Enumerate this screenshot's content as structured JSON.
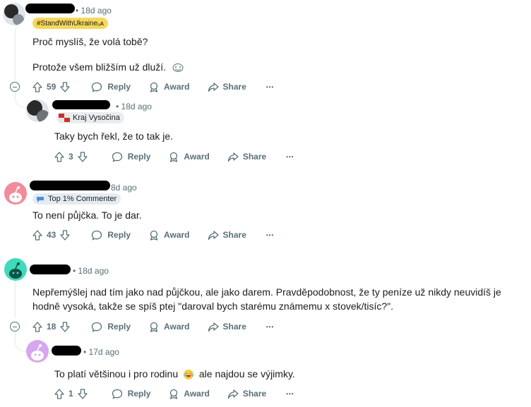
{
  "comments": [
    {
      "time": "18d ago",
      "flair": "#StandWithUkraineᵤᴀ",
      "lines": [
        "Proč myslíš, že volá tobě?",
        "Protože všem bližším už dluží."
      ],
      "votes": "59",
      "reply": "Reply",
      "award": "Award",
      "share": "Share"
    },
    {
      "time": "18d ago",
      "flair": "Kraj Vysočina",
      "text": "Taky bych řekl, že to tak je.",
      "votes": "3",
      "reply": "Reply",
      "award": "Award",
      "share": "Share"
    },
    {
      "time": "8d ago",
      "flair": "Top 1% Commenter",
      "text": "To není půjčka. To je dar.",
      "votes": "43",
      "reply": "Reply",
      "award": "Award",
      "share": "Share"
    },
    {
      "time": "18d ago",
      "text": "Nepřemýšlej nad tím jako nad půjčkou, ale jako darem. Pravděpodobnost, že ty peníze už nikdy neuvidíš je hodně vysoká, takže se spíš ptej \"daroval bych starému známemu x stovek/tisíc?\".",
      "votes": "18",
      "reply": "Reply",
      "award": "Award",
      "share": "Share"
    },
    {
      "time": "17d ago",
      "text_before": "To platí většinou i pro rodinu",
      "text_after": "ale najdou se výjimky.",
      "votes": "1",
      "reply": "Reply",
      "award": "Award",
      "share": "Share"
    }
  ],
  "icons": {
    "upvote": "upvote-icon",
    "downvote": "downvote-icon",
    "reply": "reply-icon",
    "award": "award-icon",
    "share": "share-icon",
    "more": "more-icon",
    "collapse": "collapse-icon",
    "emoji": "emoji-icon"
  },
  "colors": {
    "flair_yellow": "#f6d85a",
    "meta_gray": "#576f76",
    "avatar_pink": "#f28b9b",
    "avatar_teal": "#3ddbb8",
    "avatar_purple": "#d7a6f0"
  },
  "more_label": "•••"
}
